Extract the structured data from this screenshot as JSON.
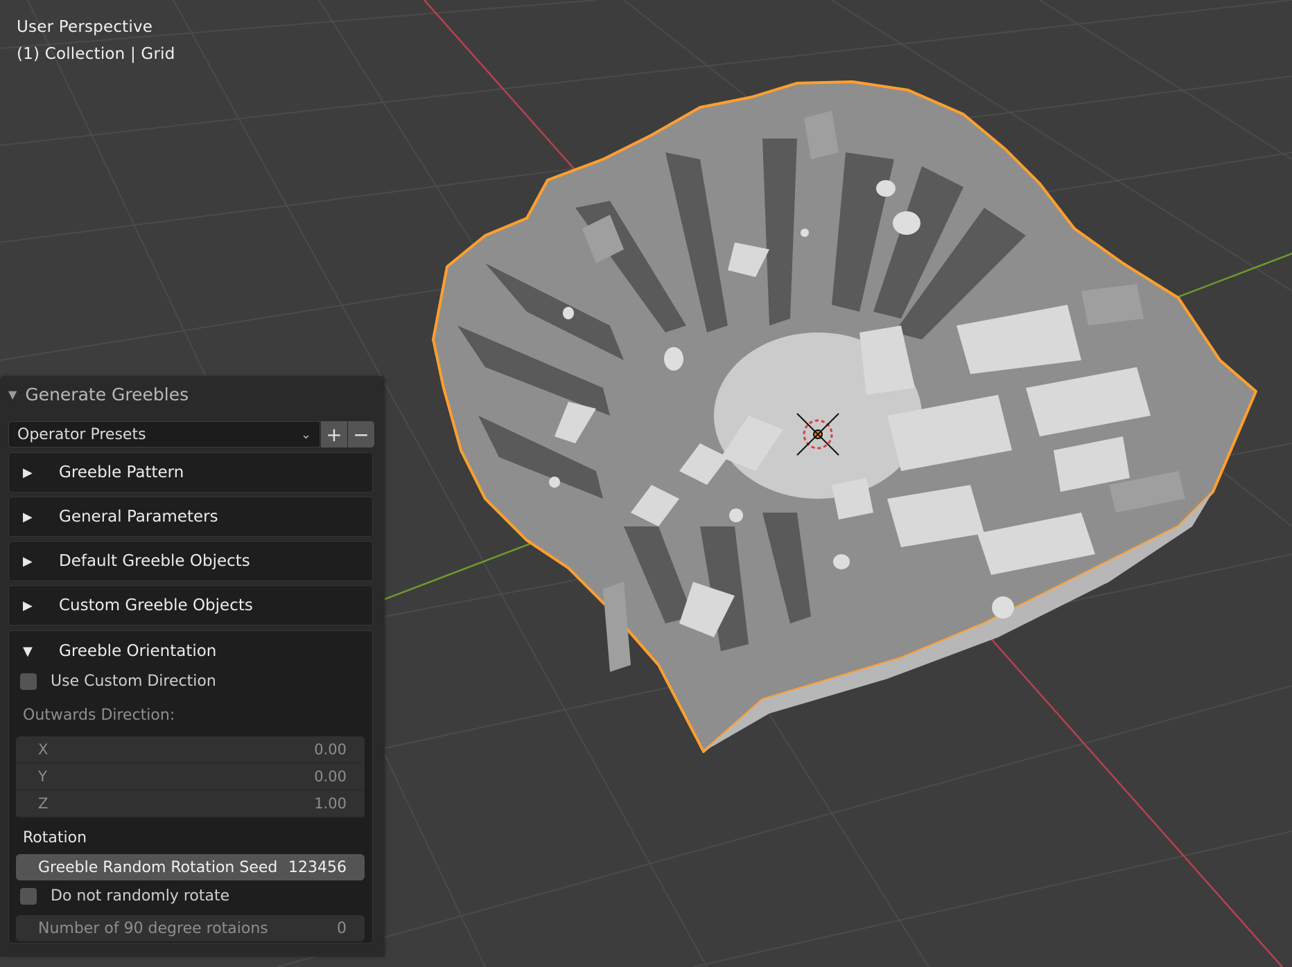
{
  "viewport": {
    "mode": "User Perspective",
    "collection": "(1) Collection | Grid",
    "colors": {
      "background": "#3d3d3d",
      "grid": "#4a4a4a",
      "x_axis": "#b8404f",
      "y_axis": "#6e9a2e",
      "selection": "#ff9f2e"
    }
  },
  "panel": {
    "title": "Generate Greebles",
    "presets": {
      "label": "Operator Presets",
      "add": "+",
      "remove": "−"
    },
    "subpanels": [
      {
        "label": "Greeble Pattern",
        "expanded": false
      },
      {
        "label": "General Parameters",
        "expanded": false
      },
      {
        "label": "Default Greeble Objects",
        "expanded": false
      },
      {
        "label": "Custom Greeble Objects",
        "expanded": false
      },
      {
        "label": "Greeble Orientation",
        "expanded": true
      }
    ],
    "orientation": {
      "use_custom_direction": {
        "label": "Use Custom Direction",
        "checked": false
      },
      "outwards_label": "Outwards Direction:",
      "x": {
        "label": "X",
        "value": "0.00"
      },
      "y": {
        "label": "Y",
        "value": "0.00"
      },
      "z": {
        "label": "Z",
        "value": "1.00"
      },
      "rotation_label": "Rotation",
      "seed": {
        "label": "Greeble Random Rotation Seed",
        "value": "123456"
      },
      "no_random_rotate": {
        "label": "Do not randomly rotate",
        "checked": false
      },
      "num_rotations": {
        "label": "Number of 90 degree rotaions",
        "value": "0"
      }
    }
  }
}
